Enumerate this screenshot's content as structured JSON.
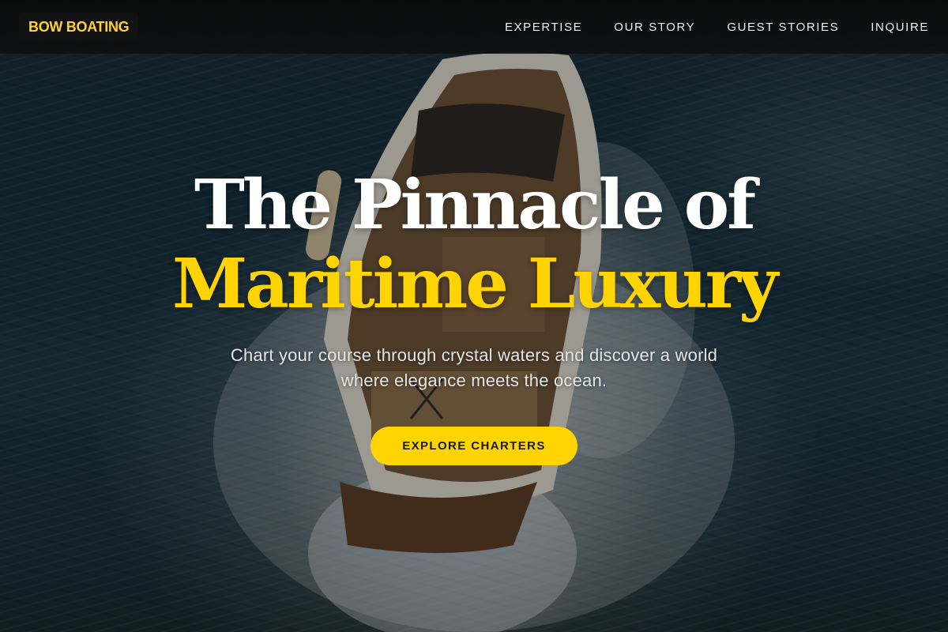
{
  "brand": {
    "name": "BOW BOATING",
    "accent_color": "#ffd400"
  },
  "nav": {
    "items": [
      {
        "label": "EXPERTISE"
      },
      {
        "label": "OUR STORY"
      },
      {
        "label": "GUEST STORIES"
      },
      {
        "label": "INQUIRE"
      }
    ]
  },
  "hero": {
    "headline_line1": "The Pinnacle of",
    "headline_line2": "Maritime Luxury",
    "subtitle": "Chart your course through crystal waters and discover a world where elegance meets the ocean.",
    "cta_label": "EXPLORE CHARTERS",
    "background_image": "aerial-speedboat-photo"
  }
}
